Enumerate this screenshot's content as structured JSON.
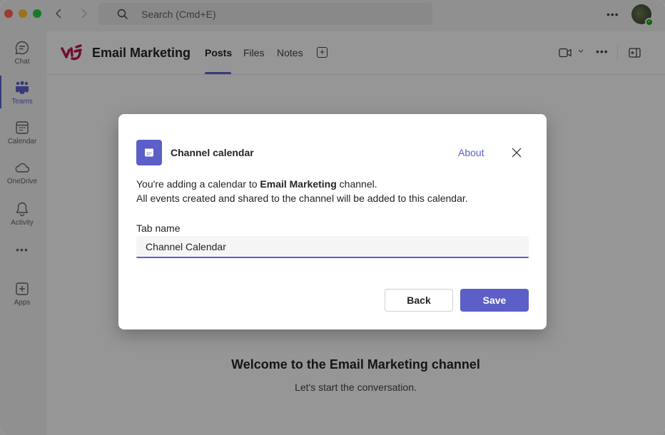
{
  "titlebar": {
    "search_placeholder": "Search (Cmd+E)",
    "more_label": "•••",
    "presence_status": "available"
  },
  "rail": {
    "items": [
      {
        "id": "chat",
        "label": "Chat",
        "icon": "chat-icon",
        "active": false
      },
      {
        "id": "teams",
        "label": "Teams",
        "icon": "teams-icon",
        "active": true
      },
      {
        "id": "calendar",
        "label": "Calendar",
        "icon": "calendar-icon",
        "active": false
      },
      {
        "id": "onedrive",
        "label": "OneDrive",
        "icon": "cloud-icon",
        "active": false
      },
      {
        "id": "activity",
        "label": "Activity",
        "icon": "bell-icon",
        "active": false
      },
      {
        "id": "apps",
        "label": "Apps",
        "icon": "add-app-icon",
        "active": false
      }
    ],
    "more_label": "•••"
  },
  "header": {
    "team_name": "Email Marketing",
    "tabs": [
      {
        "label": "Posts",
        "active": true
      },
      {
        "label": "Files",
        "active": false
      },
      {
        "label": "Notes",
        "active": false
      }
    ],
    "add_tab_label": "+",
    "more_label": "•••",
    "chevron": "⌄"
  },
  "welcome": {
    "title": "Welcome to the Email Marketing channel",
    "subtitle": "Let's start the conversation."
  },
  "dialog": {
    "title": "Channel calendar",
    "about_label": "About",
    "desc_prefix": "You're adding a calendar to ",
    "desc_channel": "Email Marketing",
    "desc_suffix": " channel.",
    "desc_line2": "All events created and shared to the channel will be added to this calendar.",
    "field_label": "Tab name",
    "field_value": "Channel Calendar",
    "back_label": "Back",
    "save_label": "Save"
  },
  "colors": {
    "accent": "#5b5fc7",
    "presence_available": "#13a10e",
    "brand_logo": "#b5174b"
  }
}
